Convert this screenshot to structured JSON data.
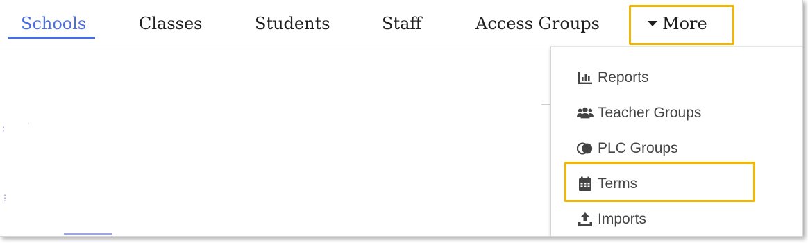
{
  "nav": {
    "tabs": [
      {
        "label": "Schools",
        "active": true
      },
      {
        "label": "Classes"
      },
      {
        "label": "Students"
      },
      {
        "label": "Staff"
      },
      {
        "label": "Access Groups"
      }
    ],
    "more_label": "More"
  },
  "dropdown": {
    "items": [
      {
        "label": "Reports",
        "icon": "bar-chart-icon"
      },
      {
        "label": "Teacher Groups",
        "icon": "users-icon"
      },
      {
        "label": "PLC Groups",
        "icon": "overlapping-circles-icon"
      },
      {
        "label": "Terms",
        "icon": "calendar-icon",
        "highlighted": true
      },
      {
        "label": "Imports",
        "icon": "upload-icon"
      }
    ]
  },
  "colors": {
    "accent": "#4a6de0",
    "highlight": "#f2b705",
    "text": "#1f1f1f",
    "menu_text": "#444444"
  }
}
